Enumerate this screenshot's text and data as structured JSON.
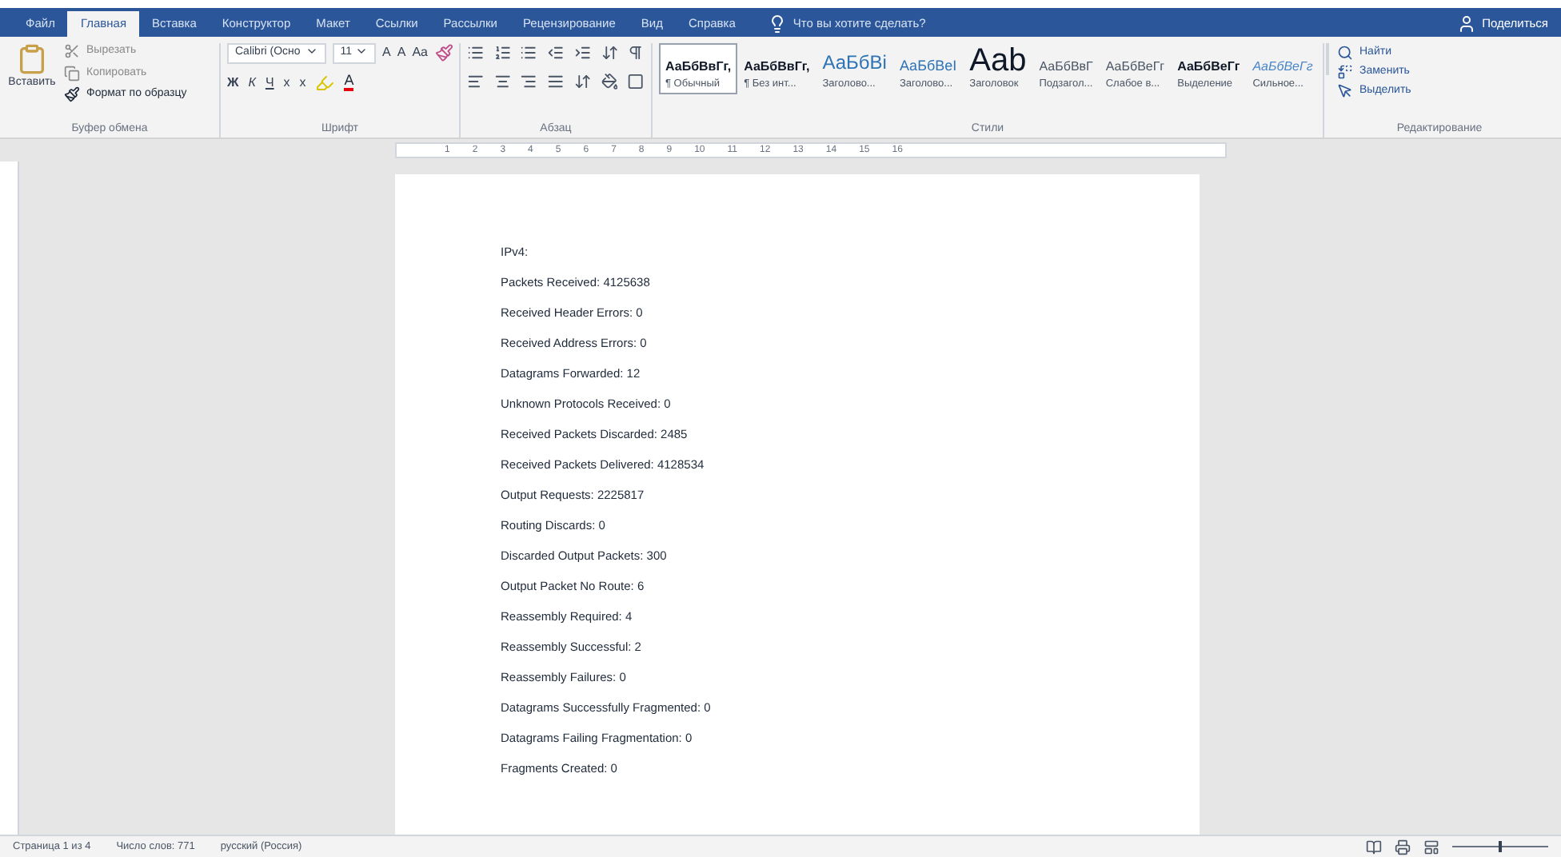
{
  "tabs": [
    {
      "label": "Файл",
      "selected": false
    },
    {
      "label": "Главная",
      "selected": true
    },
    {
      "label": "Вставка",
      "selected": false
    },
    {
      "label": "Конструктор",
      "selected": false
    },
    {
      "label": "Макет",
      "selected": false
    },
    {
      "label": "Ссылки",
      "selected": false
    },
    {
      "label": "Рассылки",
      "selected": false
    },
    {
      "label": "Рецензирование",
      "selected": false
    },
    {
      "label": "Вид",
      "selected": false
    },
    {
      "label": "Справка",
      "selected": false
    }
  ],
  "tell_me": "Что вы хотите сделать?",
  "share": "Поделиться",
  "clipboard": {
    "paste": "Вставить",
    "items": [
      {
        "label": "Вырезать",
        "disabled": true
      },
      {
        "label": "Копировать",
        "disabled": true
      },
      {
        "label": "Формат по образцу",
        "disabled": false
      }
    ],
    "group_label": "Буфер обмена"
  },
  "font": {
    "font_name": "Calibri (Осно",
    "font_size": "11",
    "row1": [
      "A",
      "A",
      "Aa"
    ],
    "row2": [
      "Ж",
      "К",
      "Ч",
      "x",
      "x"
    ],
    "font_color": "A",
    "group_label": "Шрифт"
  },
  "paragraph": {
    "group_label": "Абзац"
  },
  "styles": {
    "items": [
      {
        "sample": "АаБбВвГг,",
        "label": "¶ Обычный",
        "selected": true,
        "kind": "bold"
      },
      {
        "sample": "АаБбВвГг,",
        "label": "¶ Без инт...",
        "selected": false,
        "kind": "bold"
      },
      {
        "sample": "АаБбВі",
        "label": "Заголово...",
        "selected": false,
        "kind": "heading"
      },
      {
        "sample": "АаБбВеІ",
        "label": "Заголово...",
        "selected": false,
        "kind": "heading2"
      },
      {
        "sample": "Aab",
        "label": "Заголовок",
        "selected": false,
        "kind": "title"
      },
      {
        "sample": "АаБбВвГ",
        "label": "Подзагол...",
        "selected": false,
        "kind": "plain"
      },
      {
        "sample": "АаБбВеГг",
        "label": "Слабое в...",
        "selected": false,
        "kind": "plain"
      },
      {
        "sample": "АаБбВеГг",
        "label": "Выделение",
        "selected": false,
        "kind": "bold"
      },
      {
        "sample": "АаБбВеГг",
        "label": "Сильное...",
        "selected": false,
        "kind": "accent"
      }
    ],
    "group_label": "Стили"
  },
  "editing": {
    "items": [
      "Найти",
      "Заменить",
      "Выделить"
    ],
    "group_label": "Редактирование"
  },
  "ruler_numbers": [
    "1",
    "2",
    "3",
    "4",
    "5",
    "6",
    "7",
    "8",
    "9",
    "10",
    "11",
    "12",
    "13",
    "14",
    "15",
    "16"
  ],
  "document": {
    "lines": [
      "IPv4:",
      "Packets Received: 4125638",
      "Received Header Errors: 0",
      "Received Address Errors: 0",
      "Datagrams Forwarded: 12",
      "Unknown Protocols Received: 0",
      "Received Packets Discarded: 2485",
      "Received Packets Delivered: 4128534",
      "Output Requests: 2225817",
      "Routing Discards: 0",
      "Discarded Output Packets: 300",
      "Output Packet No Route: 6",
      "Reassembly Required: 4",
      "Reassembly Successful: 2",
      "Reassembly Failures: 0",
      "Datagrams Successfully Fragmented: 0",
      "Datagrams Failing Fragmentation: 0",
      "Fragments Created: 0"
    ]
  },
  "zoom": {
    "level": 0.5
  },
  "status_bar": [
    "Страница 1 из 4",
    "Число слов: 771",
    "русский (Россия)"
  ]
}
